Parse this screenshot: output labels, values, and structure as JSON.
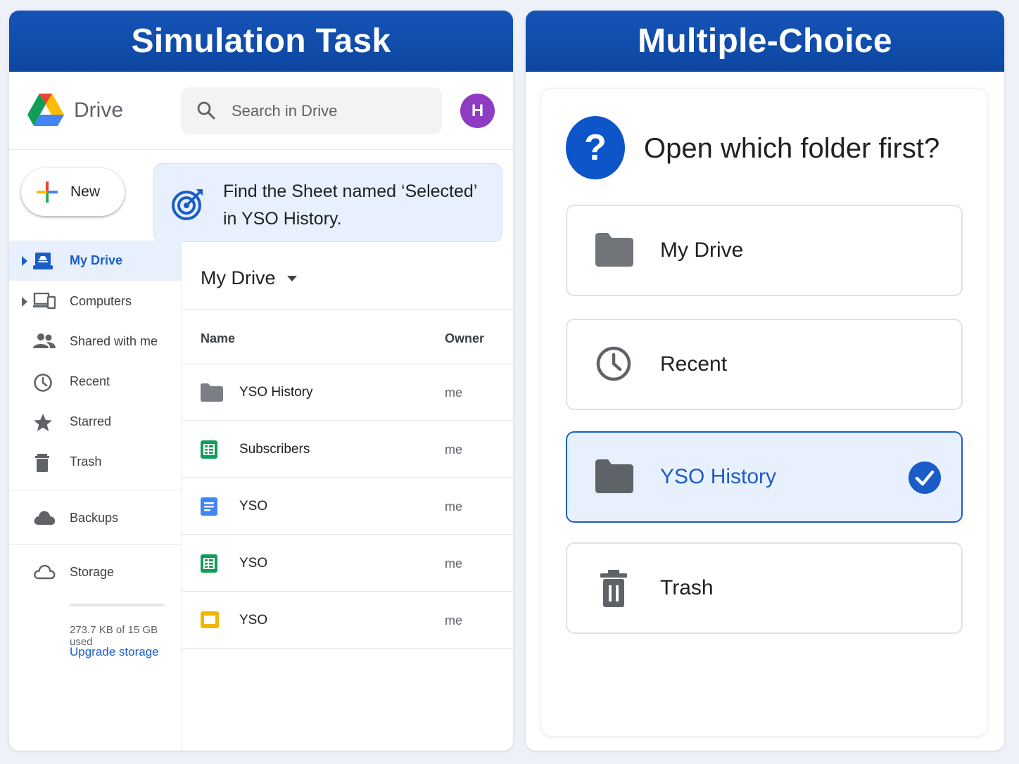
{
  "left_panel": {
    "banner": "Simulation Task",
    "header": {
      "app_name": "Drive",
      "search_placeholder": "Search in Drive",
      "avatar_initial": "H"
    },
    "new_button": "New",
    "task": "Find the Sheet named ‘Selected’ in YSO History.",
    "sidebar": {
      "items": [
        {
          "label": "My Drive",
          "icon": "my-drive-icon",
          "active": true
        },
        {
          "label": "Computers",
          "icon": "computers-icon"
        },
        {
          "label": "Shared with me",
          "icon": "people-icon"
        },
        {
          "label": "Recent",
          "icon": "clock-icon"
        },
        {
          "label": "Starred",
          "icon": "star-icon"
        },
        {
          "label": "Trash",
          "icon": "trash-icon"
        },
        {
          "label": "Backups",
          "icon": "cloud-icon"
        },
        {
          "label": "Storage",
          "icon": "cloud-outline-icon"
        }
      ],
      "storage_used": "273.7 KB of 15 GB used",
      "storage_fraction": 0.0,
      "upgrade": "Upgrade storage"
    },
    "main": {
      "breadcrumb": "My Drive",
      "columns": {
        "name": "Name",
        "owner": "Owner"
      },
      "files": [
        {
          "name": "YSO History",
          "owner": "me",
          "type": "folder"
        },
        {
          "name": "Subscribers",
          "owner": "me",
          "type": "sheet"
        },
        {
          "name": "YSO",
          "owner": "me",
          "type": "doc"
        },
        {
          "name": "YSO",
          "owner": "me",
          "type": "sheet"
        },
        {
          "name": "YSO",
          "owner": "me",
          "type": "slides"
        }
      ]
    }
  },
  "right_panel": {
    "banner": "Multiple-Choice",
    "question": "Open which folder first?",
    "options": [
      {
        "label": "My Drive",
        "icon": "folder-icon",
        "selected": false
      },
      {
        "label": "Recent",
        "icon": "clock-icon",
        "selected": false
      },
      {
        "label": "YSO History",
        "icon": "folder-icon",
        "selected": true
      },
      {
        "label": "Trash",
        "icon": "trash-icon",
        "selected": false
      }
    ]
  },
  "colors": {
    "banner": "#0d47a1",
    "accent": "#1a5dc8",
    "selected_bg": "#e8f0fd",
    "avatar": "#8e3cc4"
  }
}
